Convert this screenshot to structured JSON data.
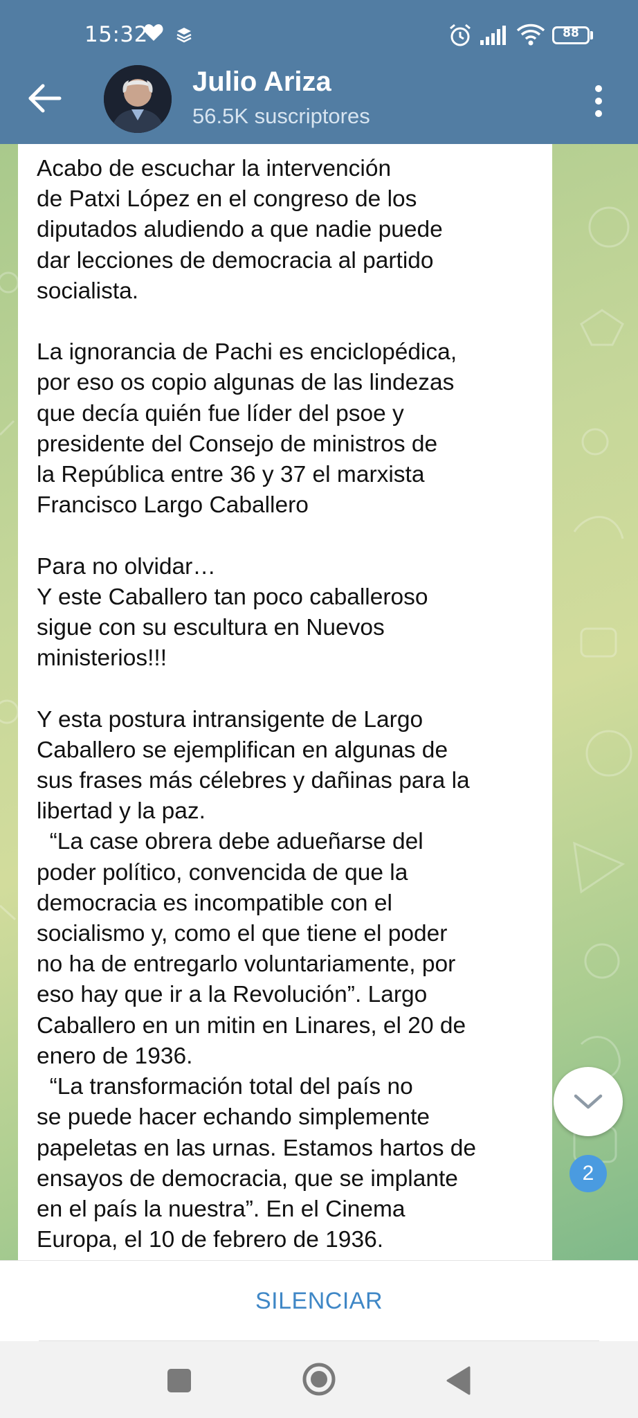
{
  "status_bar": {
    "time": "15:32",
    "battery": "88",
    "icons": [
      "heart-icon",
      "layers-icon",
      "alarm-icon",
      "signal-icon",
      "wifi-icon",
      "battery-icon"
    ]
  },
  "header": {
    "title": "Julio Ariza",
    "subtitle": "56.5K suscriptores",
    "background_color": "#527da3",
    "icons": [
      "back-arrow-icon",
      "more-vertical-icon"
    ]
  },
  "message": {
    "text": "Acabo de escuchar la intervención\nde Patxi López en el congreso de los\ndiputados aludiendo a que nadie puede\ndar lecciones de democracia al partido\nsocialista.\n\nLa ignorancia de Pachi es enciclopédica,\npor eso os copio algunas de las lindezas\nque decía quién fue líder del psoe y\npresidente del Consejo de ministros de\nla República entre 36 y 37 el marxista\nFrancisco Largo Caballero\n\nPara no olvidar…\nY este Caballero tan poco caballeroso\nsigue con su escultura en Nuevos\nministerios!!!\n\nY esta postura intransigente de Largo\nCaballero se ejemplifican en algunas de\nsus frases más célebres y dañinas para la\nlibertad y la paz.\n  “La case obrera debe adueñarse del\npoder político, convencida de que la\ndemocracia es incompatible con el\nsocialismo y, como el que tiene el poder\nno ha de entregarlo voluntariamente, por\neso hay que ir a la Revolución”. Largo\nCaballero en un mitin en Linares, el 20 de\nenero de 1936.\n  “La transformación total del país no\nse puede hacer echando simplemente\npapeletas en las urnas. Estamos hartos de\nensayos de democracia, que se implante\nen el país la nuestra”. En el Cinema\nEuropa, el 10 de febrero de 1936.\n  “Si no nos permiten conquistar el poder"
  },
  "scroll_button": {
    "unread_count": "2",
    "badge_color": "#4a9be0",
    "icon": "chevron-down-icon"
  },
  "bottom_bar": {
    "mute_label": "SILENCIAR",
    "label_color": "#3f87c6"
  },
  "system_nav": {
    "icons": [
      "recents-square-icon",
      "home-circle-icon",
      "back-triangle-icon"
    ]
  }
}
